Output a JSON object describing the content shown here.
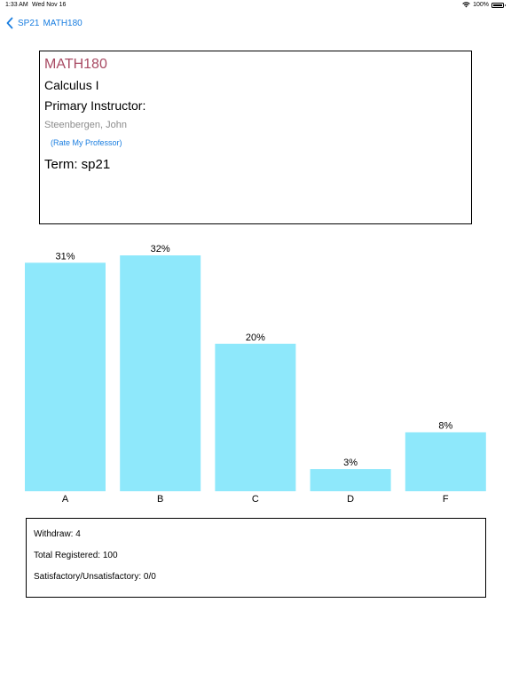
{
  "status_bar": {
    "time": "1:33 AM",
    "date": "Wed Nov 16",
    "battery": "100%"
  },
  "nav": {
    "back_label": "SP21",
    "title": "MATH180"
  },
  "course": {
    "code": "MATH180",
    "title": "Calculus I",
    "primary_label": "Primary Instructor:",
    "instructor": "Steenbergen, John",
    "rmp_link": "(Rate My Professor)",
    "term": "Term: sp21"
  },
  "colors": {
    "accent": "#1a7ee0",
    "course_code": "#a84a63",
    "bar": "#8ee8fb"
  },
  "chart_data": {
    "type": "bar",
    "categories": [
      "A",
      "B",
      "C",
      "D",
      "F"
    ],
    "values": [
      31,
      32,
      20,
      3,
      8
    ],
    "value_labels": [
      "31%",
      "32%",
      "20%",
      "3%",
      "8%"
    ],
    "ylim": [
      0,
      32
    ],
    "grid": false
  },
  "stats": {
    "withdraw": "Withdraw: 4",
    "total_registered": "Total Registered: 100",
    "satisfactory": "Satisfactory/Unsatisfactory: 0/0"
  }
}
